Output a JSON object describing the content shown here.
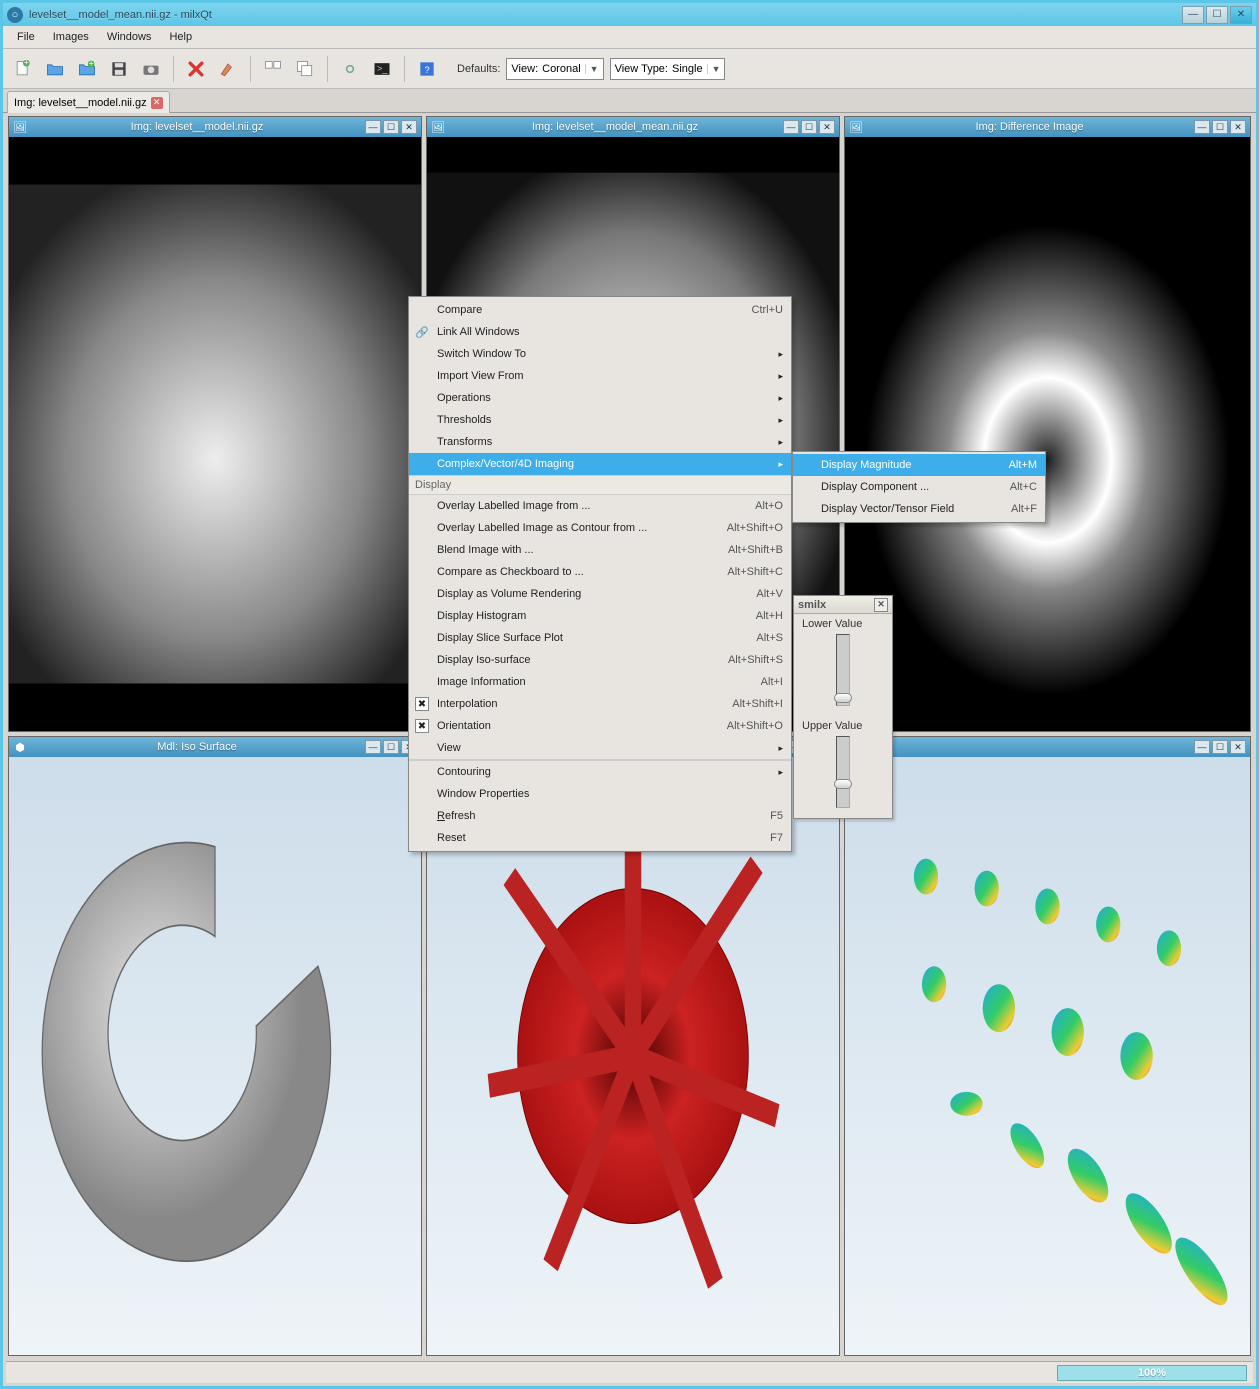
{
  "window": {
    "title": "levelset__model_mean.nii.gz - milxQt"
  },
  "menubar": [
    "File",
    "Images",
    "Windows",
    "Help"
  ],
  "defaults": {
    "label": "Defaults:",
    "view_label": "View:",
    "view_value": "Coronal",
    "type_label": "View Type:",
    "type_value": "Single"
  },
  "tab": {
    "label": "Img: levelset__model.nii.gz"
  },
  "subwindows": {
    "img1": "Img: levelset__model.nii.gz",
    "img2": "Img: levelset__model_mean.nii.gz",
    "img3": "Img: Difference Image",
    "mdl1": "Mdl: Iso Surface"
  },
  "float_panel": {
    "title": "smilx",
    "lower": "Lower Value",
    "upper": "Upper Value"
  },
  "context_menu": {
    "compare": "Compare",
    "compare_sc": "Ctrl+U",
    "link_all": "Link All Windows",
    "switch_to": "Switch Window To",
    "import_view": "Import View From",
    "operations": "Operations",
    "thresholds": "Thresholds",
    "transforms": "Transforms",
    "complex": "Complex/Vector/4D Imaging",
    "display_section": "Display",
    "overlay_from": "Overlay Labelled Image from ...",
    "overlay_from_sc": "Alt+O",
    "overlay_contour": "Overlay Labelled Image as Contour from ...",
    "overlay_contour_sc": "Alt+Shift+O",
    "blend": "Blend Image with ...",
    "blend_sc": "Alt+Shift+B",
    "compare_check": "Compare as Checkboard to ...",
    "compare_check_sc": "Alt+Shift+C",
    "vol_render": "Display as Volume Rendering",
    "vol_render_sc": "Alt+V",
    "histogram": "Display Histogram",
    "histogram_sc": "Alt+H",
    "slice_plot": "Display Slice Surface Plot",
    "slice_plot_sc": "Alt+S",
    "iso": "Display Iso-surface",
    "iso_sc": "Alt+Shift+S",
    "info": "Image Information",
    "info_sc": "Alt+I",
    "interp": "Interpolation",
    "interp_sc": "Alt+Shift+I",
    "orient": "Orientation",
    "orient_sc": "Alt+Shift+O",
    "view": "View",
    "contouring": "Contouring",
    "winprops": "Window Properties",
    "refresh": "Refresh",
    "refresh_sc": "F5",
    "reset": "Reset",
    "reset_sc": "F7"
  },
  "submenu": {
    "mag": "Display Magnitude",
    "mag_sc": "Alt+M",
    "comp": "Display Component ...",
    "comp_sc": "Alt+C",
    "vec": "Display Vector/Tensor Field",
    "vec_sc": "Alt+F"
  },
  "status": {
    "progress": "100%"
  }
}
